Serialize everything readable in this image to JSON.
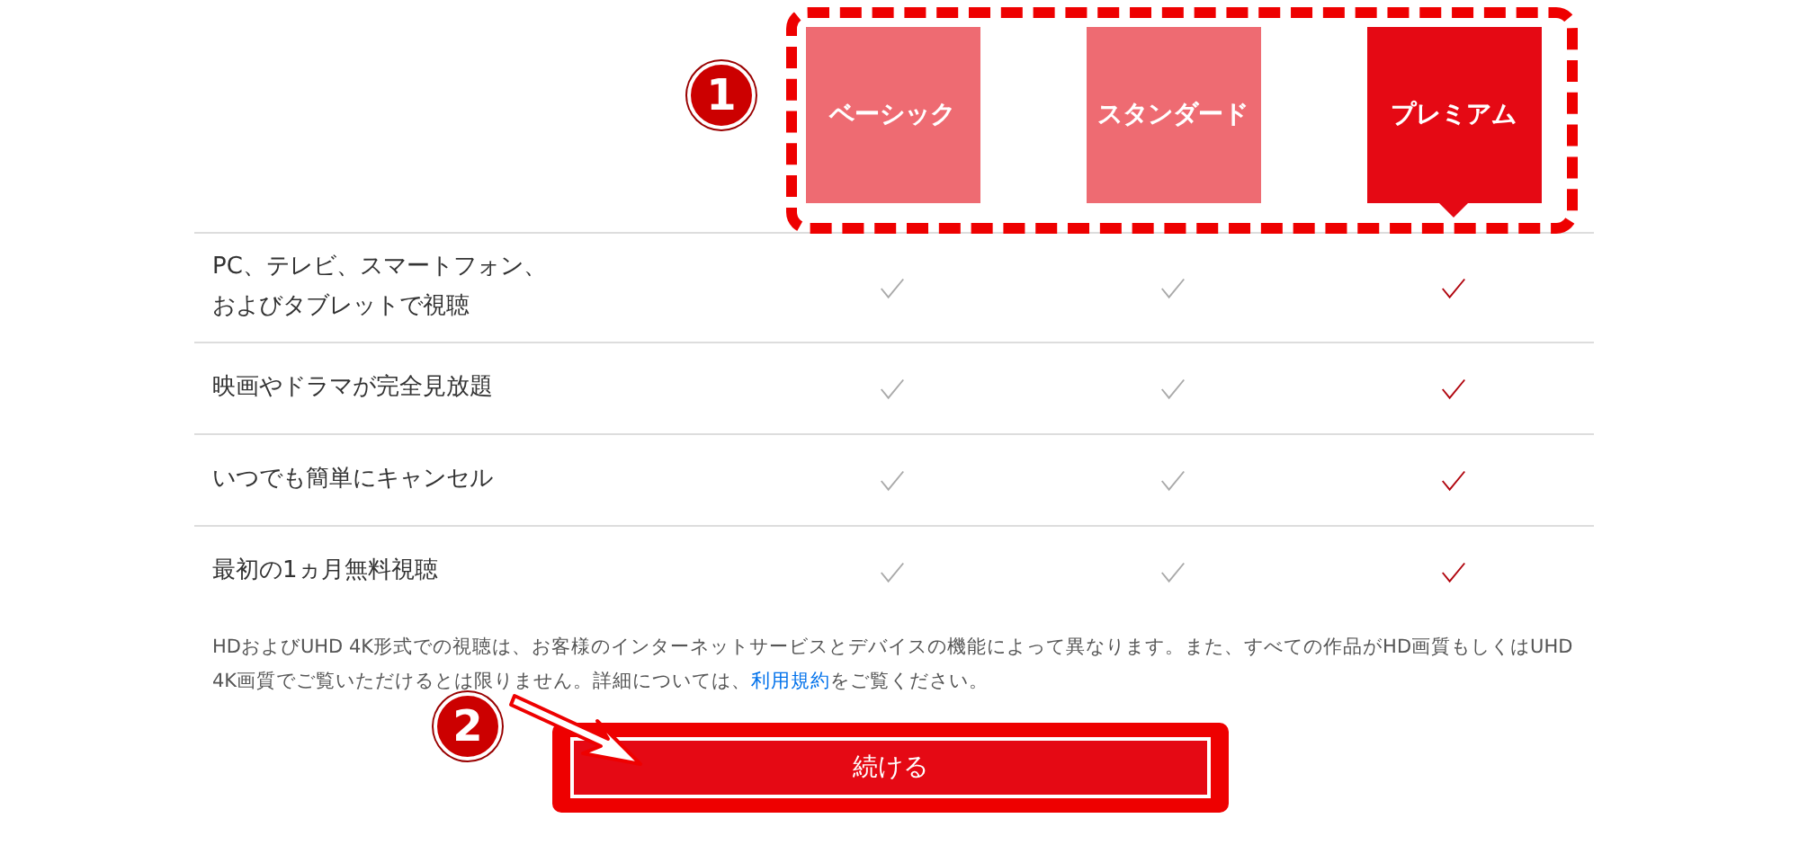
{
  "plans": [
    {
      "name": "ベーシック",
      "selected": false
    },
    {
      "name": "スタンダード",
      "selected": false
    },
    {
      "name": "プレミアム",
      "selected": true
    }
  ],
  "features": [
    {
      "lines": [
        "PC、テレビ、スマートフォン、",
        "およびタブレットで視聴"
      ],
      "included": [
        true,
        true,
        true
      ]
    },
    {
      "lines": [
        "映画やドラマが完全見放題"
      ],
      "included": [
        true,
        true,
        true
      ]
    },
    {
      "lines": [
        "いつでも簡単にキャンセル"
      ],
      "included": [
        true,
        true,
        true
      ]
    },
    {
      "lines": [
        "最初の1ヵ月無料視聴"
      ],
      "included": [
        true,
        true,
        true
      ]
    }
  ],
  "note": {
    "text_before": "HDおよびUHD 4K形式での視聴は、お客様のインターネットサービスとデバイスの機能によって異なります。また、すべての作品がHD画質もしくはUHD 4K画質でご覧いただけるとは限りません。詳細については、",
    "link": "利用規約",
    "text_after": "をご覧ください。"
  },
  "continue_button": "続ける",
  "annotations": [
    {
      "number": "1"
    },
    {
      "number": "2"
    }
  ]
}
